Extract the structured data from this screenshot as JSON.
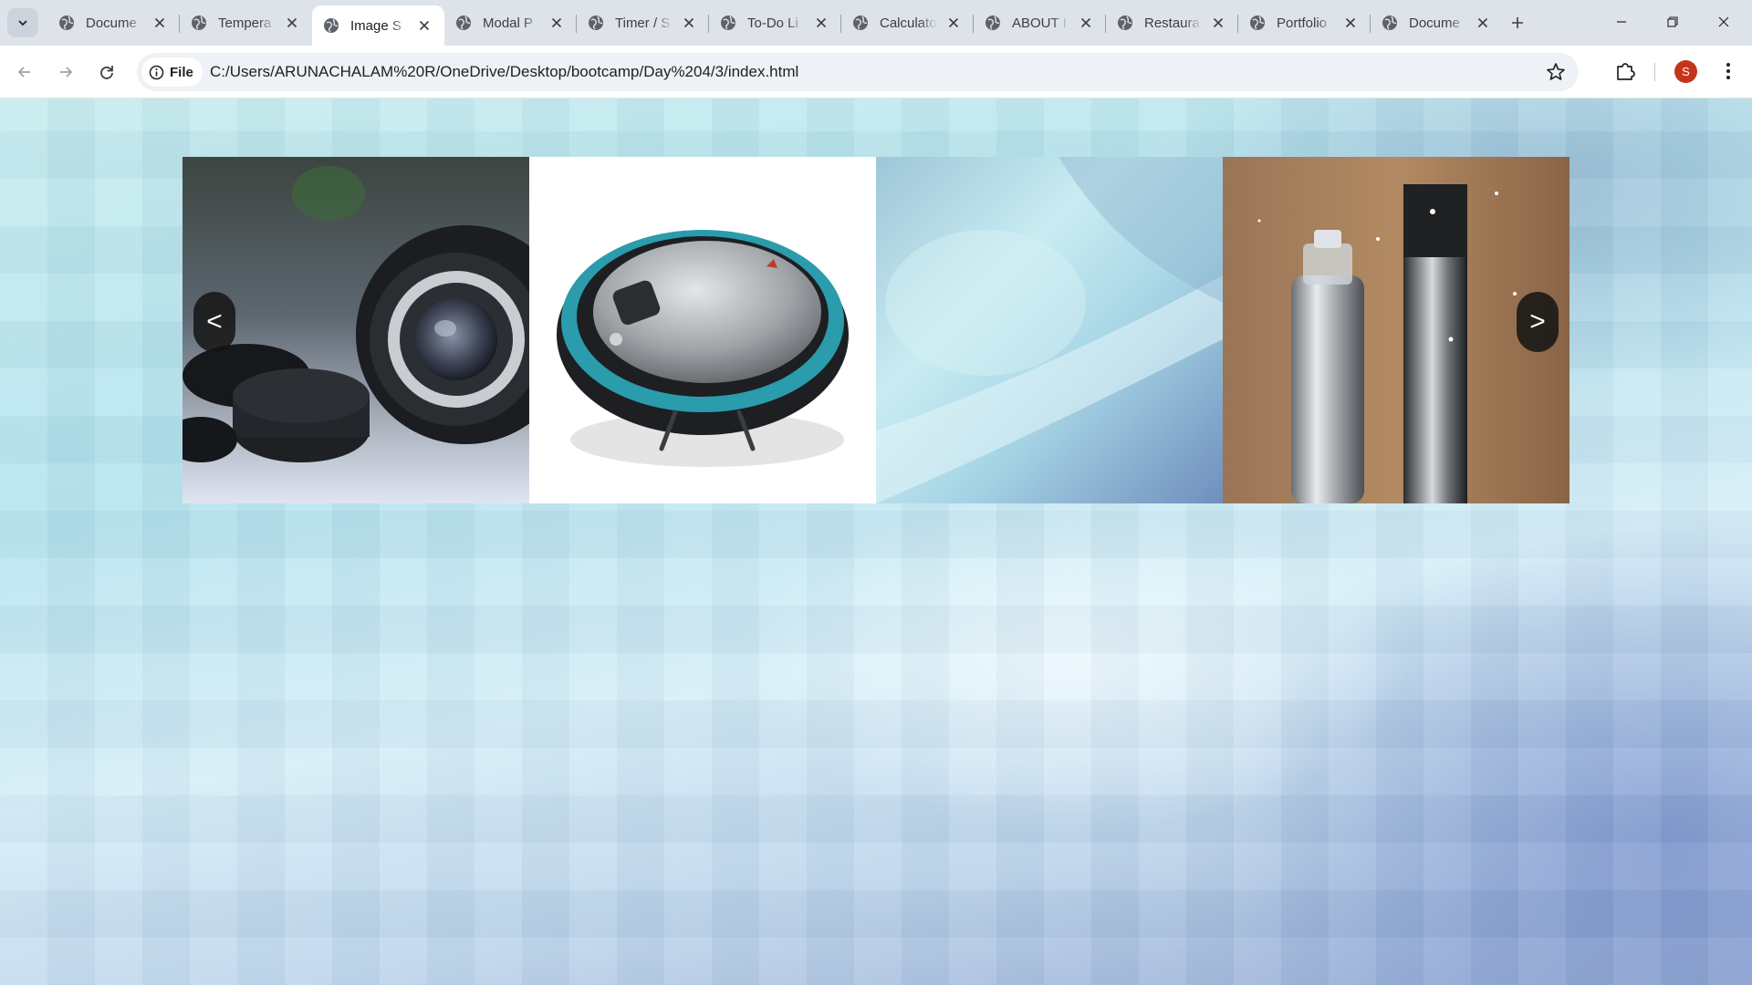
{
  "browser": {
    "tabs": [
      {
        "title": "Docume",
        "active": false
      },
      {
        "title": "Tempera",
        "active": false
      },
      {
        "title": "Image S",
        "active": true
      },
      {
        "title": "Modal P",
        "active": false
      },
      {
        "title": "Timer / S",
        "active": false
      },
      {
        "title": "To-Do Li",
        "active": false
      },
      {
        "title": "Calculato",
        "active": false
      },
      {
        "title": "ABOUT I",
        "active": false
      },
      {
        "title": "Restaura",
        "active": false
      },
      {
        "title": "Portfolio",
        "active": false
      },
      {
        "title": "Docume",
        "active": false
      }
    ],
    "site_chip": "File",
    "url": "C:/Users/ARUNACHALAM%20R/OneDrive/Desktop/bootcamp/Day%204/3/index.html",
    "profile_initial": "S",
    "accent_color": "#c5351c"
  },
  "slider": {
    "prev_label": "<",
    "next_label": ">",
    "slides": [
      {
        "subject": "camera-lens"
      },
      {
        "subject": "robot-vacuum"
      },
      {
        "subject": "abstract-blue"
      },
      {
        "subject": "cosmetic-bottles"
      }
    ]
  }
}
